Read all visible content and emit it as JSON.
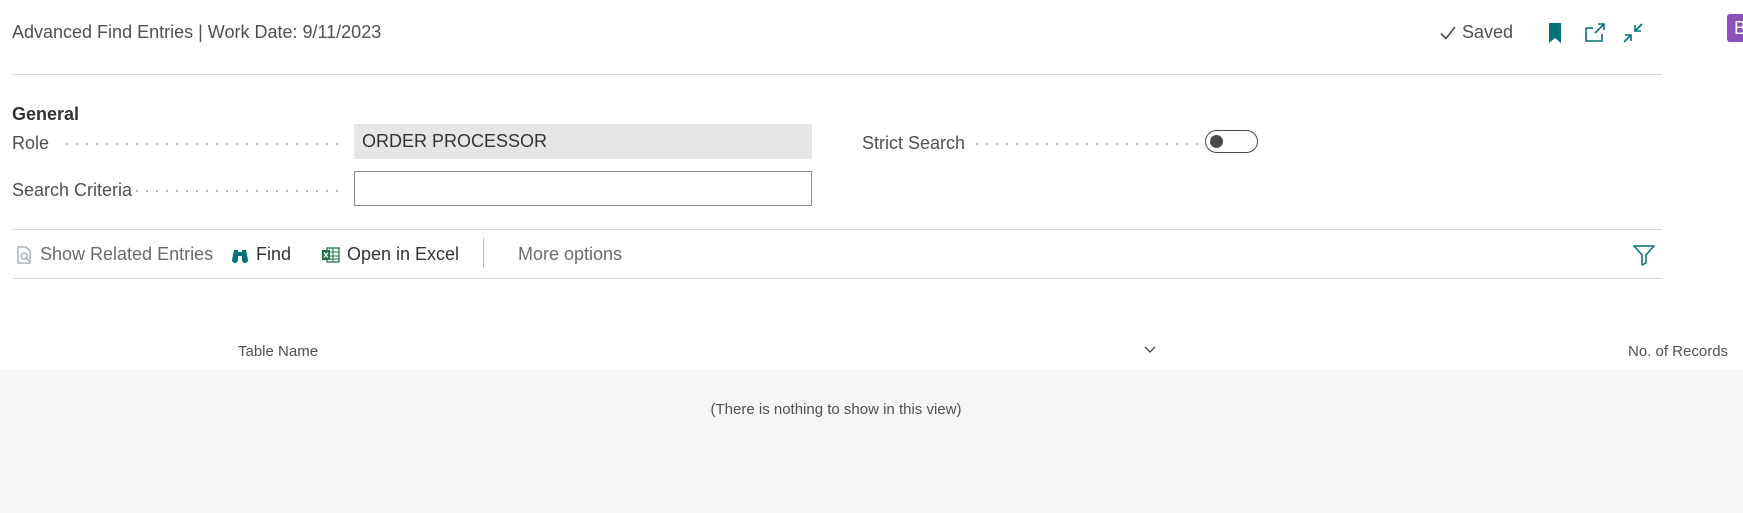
{
  "header": {
    "title": "Advanced Find Entries | Work Date: 9/11/2023",
    "saved_label": "Saved",
    "avatar_initial": "B",
    "icons": [
      "bookmark-icon",
      "open-new-window-icon",
      "collapse-icon"
    ]
  },
  "general": {
    "section_title": "General",
    "role_label": "Role",
    "role_value": "ORDER PROCESSOR",
    "search_criteria_label": "Search Criteria",
    "search_criteria_value": "",
    "strict_search_label": "Strict Search",
    "strict_search_on": false
  },
  "actions": {
    "show_related_entries": "Show Related Entries",
    "find": "Find",
    "open_in_excel": "Open in Excel",
    "more_options": "More options"
  },
  "table": {
    "columns": [
      "Table Name",
      "No. of Records"
    ],
    "empty_message": "(There is nothing to show in this view)"
  },
  "colors": {
    "accent": "#00727a",
    "avatar": "#8a52b8",
    "excel_green": "#217346"
  }
}
